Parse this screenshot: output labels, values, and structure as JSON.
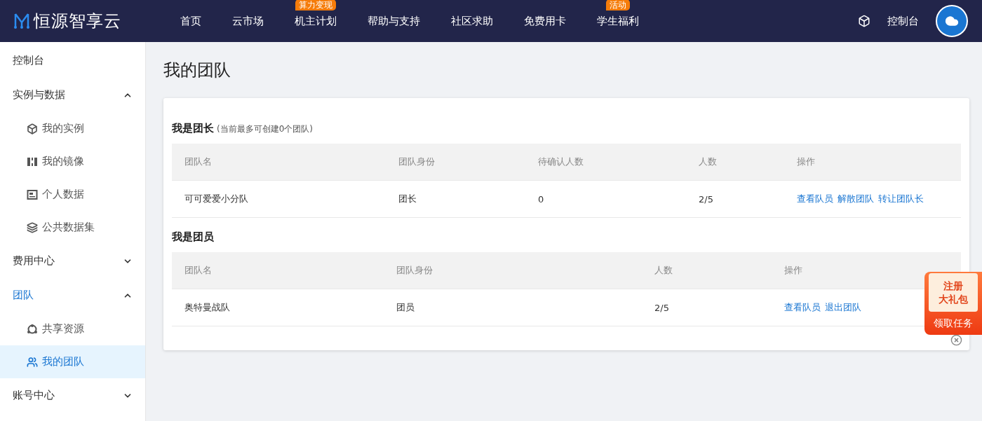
{
  "header": {
    "logo": "恒源智享云",
    "nav": [
      {
        "label": "首页"
      },
      {
        "label": "云市场"
      },
      {
        "label": "机主计划",
        "badge": "算力变现"
      },
      {
        "label": "帮助与支持"
      },
      {
        "label": "社区求助"
      },
      {
        "label": "免费用卡"
      },
      {
        "label": "学生福利",
        "badge": "活动"
      }
    ],
    "console": "控制台"
  },
  "sidebar": {
    "items": [
      {
        "label": "控制台",
        "selected": false
      },
      {
        "label": "实例与数据",
        "selected": false,
        "expanded": true,
        "children": [
          {
            "label": "我的实例",
            "selected": false
          },
          {
            "label": "我的镜像",
            "selected": false
          },
          {
            "label": "个人数据",
            "selected": false
          },
          {
            "label": "公共数据集",
            "selected": false
          }
        ]
      },
      {
        "label": "费用中心",
        "selected": false,
        "expanded": false
      },
      {
        "label": "团队",
        "selected": false,
        "expanded": true,
        "children": [
          {
            "label": "共享资源",
            "selected": false
          },
          {
            "label": "我的团队",
            "selected": true
          }
        ]
      },
      {
        "label": "账号中心",
        "selected": false,
        "expanded": false
      }
    ]
  },
  "page": {
    "title": "我的团队",
    "sections": [
      {
        "title": "我是团长",
        "note": "(当前最多可创建0个团队)",
        "columns": [
          "团队名",
          "团队身份",
          "待确认人数",
          "人数",
          "操作"
        ],
        "rows": [
          {
            "cells": [
              "可可爱爱小分队",
              "团长",
              "0",
              "2/5"
            ],
            "actions": [
              "查看队员",
              "解散团队",
              "转让团队长"
            ]
          }
        ]
      },
      {
        "title": "我是团员",
        "columns": [
          "团队名",
          "团队身份",
          "人数",
          "操作"
        ],
        "rows": [
          {
            "cells": [
              "奥特曼战队",
              "团员",
              "2/5"
            ],
            "actions": [
              "查看队员",
              "退出团队"
            ]
          }
        ]
      }
    ]
  },
  "promo": {
    "title_lines": [
      "注册",
      "大礼包"
    ],
    "button": "领取任务"
  }
}
